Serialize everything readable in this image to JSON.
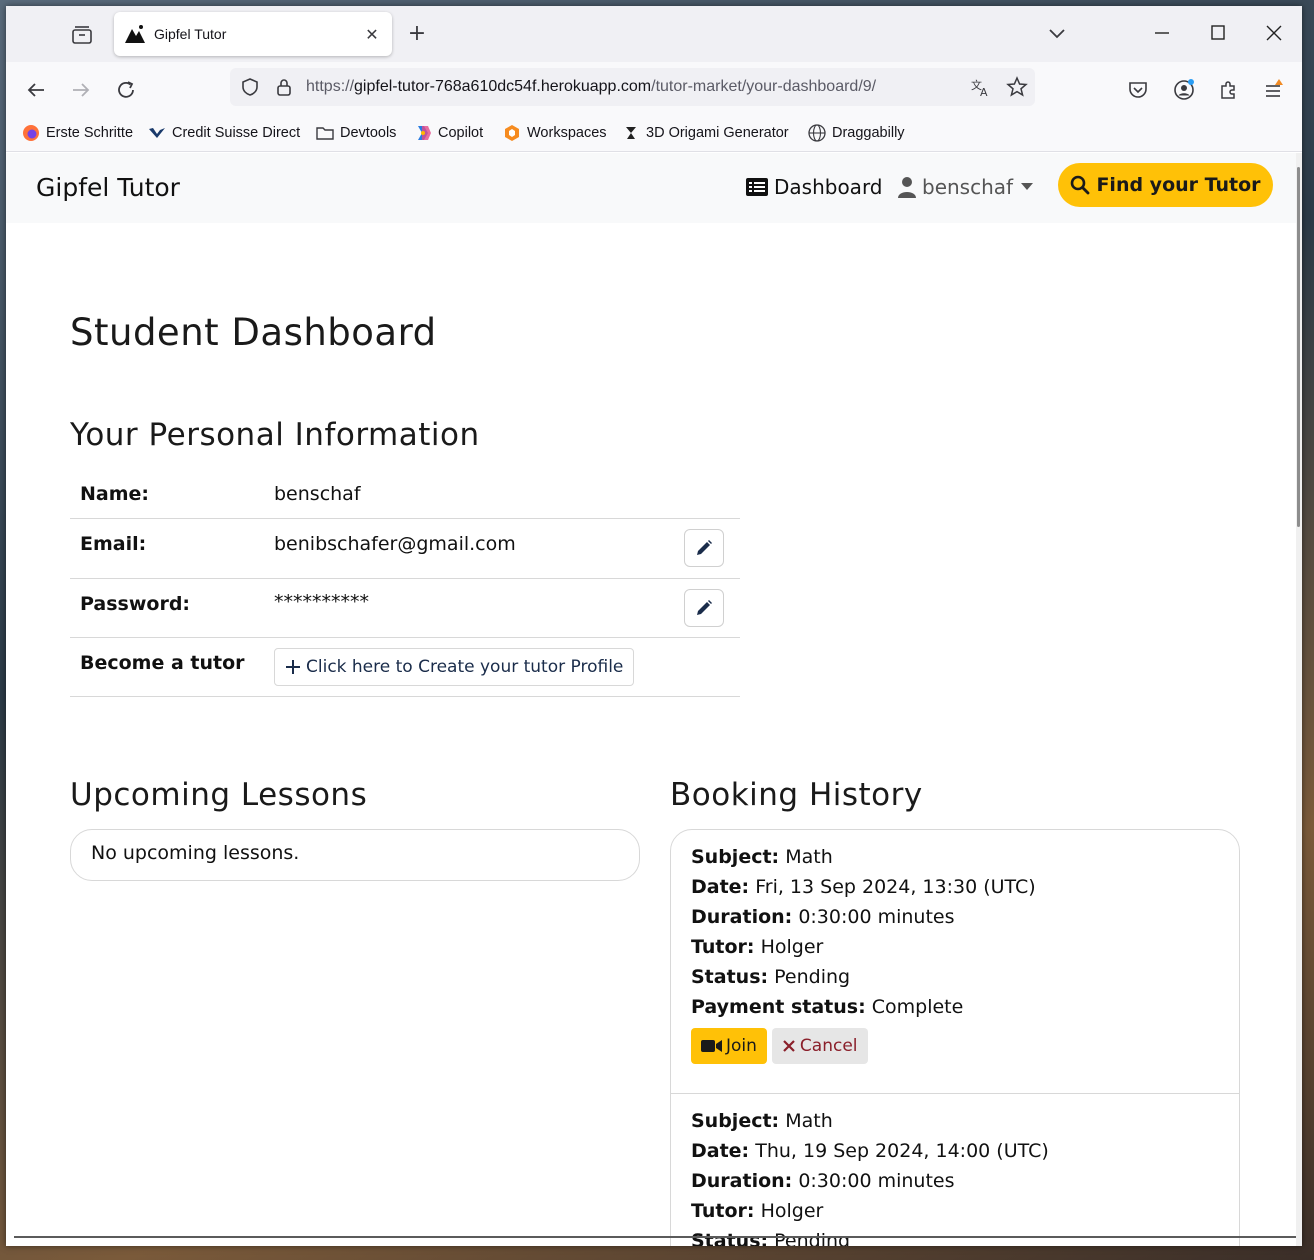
{
  "browser": {
    "tab_title": "Gipfel Tutor",
    "url_prefix": "https://",
    "url_host": "gipfel-tutor-768a610dc54f.herokuapp.com",
    "url_path": "/tutor-market/your-dashboard/9/",
    "bookmarks": [
      {
        "label": "Erste Schritte",
        "icon": "firefox-icon"
      },
      {
        "label": "Credit Suisse Direct",
        "icon": "credit-suisse-icon"
      },
      {
        "label": "Devtools",
        "icon": "folder-icon"
      },
      {
        "label": "Copilot",
        "icon": "copilot-icon"
      },
      {
        "label": "Workspaces",
        "icon": "workspaces-icon"
      },
      {
        "label": "3D Origami Generator",
        "icon": "origami-icon"
      },
      {
        "label": "Draggabilly",
        "icon": "globe-icon"
      }
    ]
  },
  "site": {
    "brand": "Gipfel Tutor",
    "nav": {
      "dashboard": "Dashboard",
      "user": "benschaf",
      "find_tutor": "Find your Tutor"
    },
    "accent_color": "#ffc107"
  },
  "main": {
    "title": "Student Dashboard",
    "personal_heading": "Your Personal Information",
    "personal": {
      "name_label": "Name:",
      "name_value": "benschaf",
      "email_label": "Email:",
      "email_value": "benibschafer@gmail.com",
      "password_label": "Password:",
      "password_value": "**********",
      "tutor_label": "Become a tutor",
      "tutor_button": "Click here to Create your tutor Profile"
    },
    "upcoming_heading": "Upcoming Lessons",
    "upcoming_empty": "No upcoming lessons.",
    "history_heading": "Booking History",
    "labels": {
      "subject": "Subject:",
      "date": "Date:",
      "duration": "Duration:",
      "tutor": "Tutor:",
      "status": "Status:",
      "payment": "Payment status:",
      "join": "Join",
      "cancel": "Cancel"
    },
    "bookings": [
      {
        "subject": "Math",
        "date": "Fri, 13 Sep 2024, 13:30 (UTC)",
        "duration": "0:30:00 minutes",
        "tutor": "Holger",
        "status": "Pending",
        "payment": "Complete"
      },
      {
        "subject": "Math",
        "date": "Thu, 19 Sep 2024, 14:00 (UTC)",
        "duration": "0:30:00 minutes",
        "tutor": "Holger",
        "status": "Pending"
      }
    ]
  }
}
